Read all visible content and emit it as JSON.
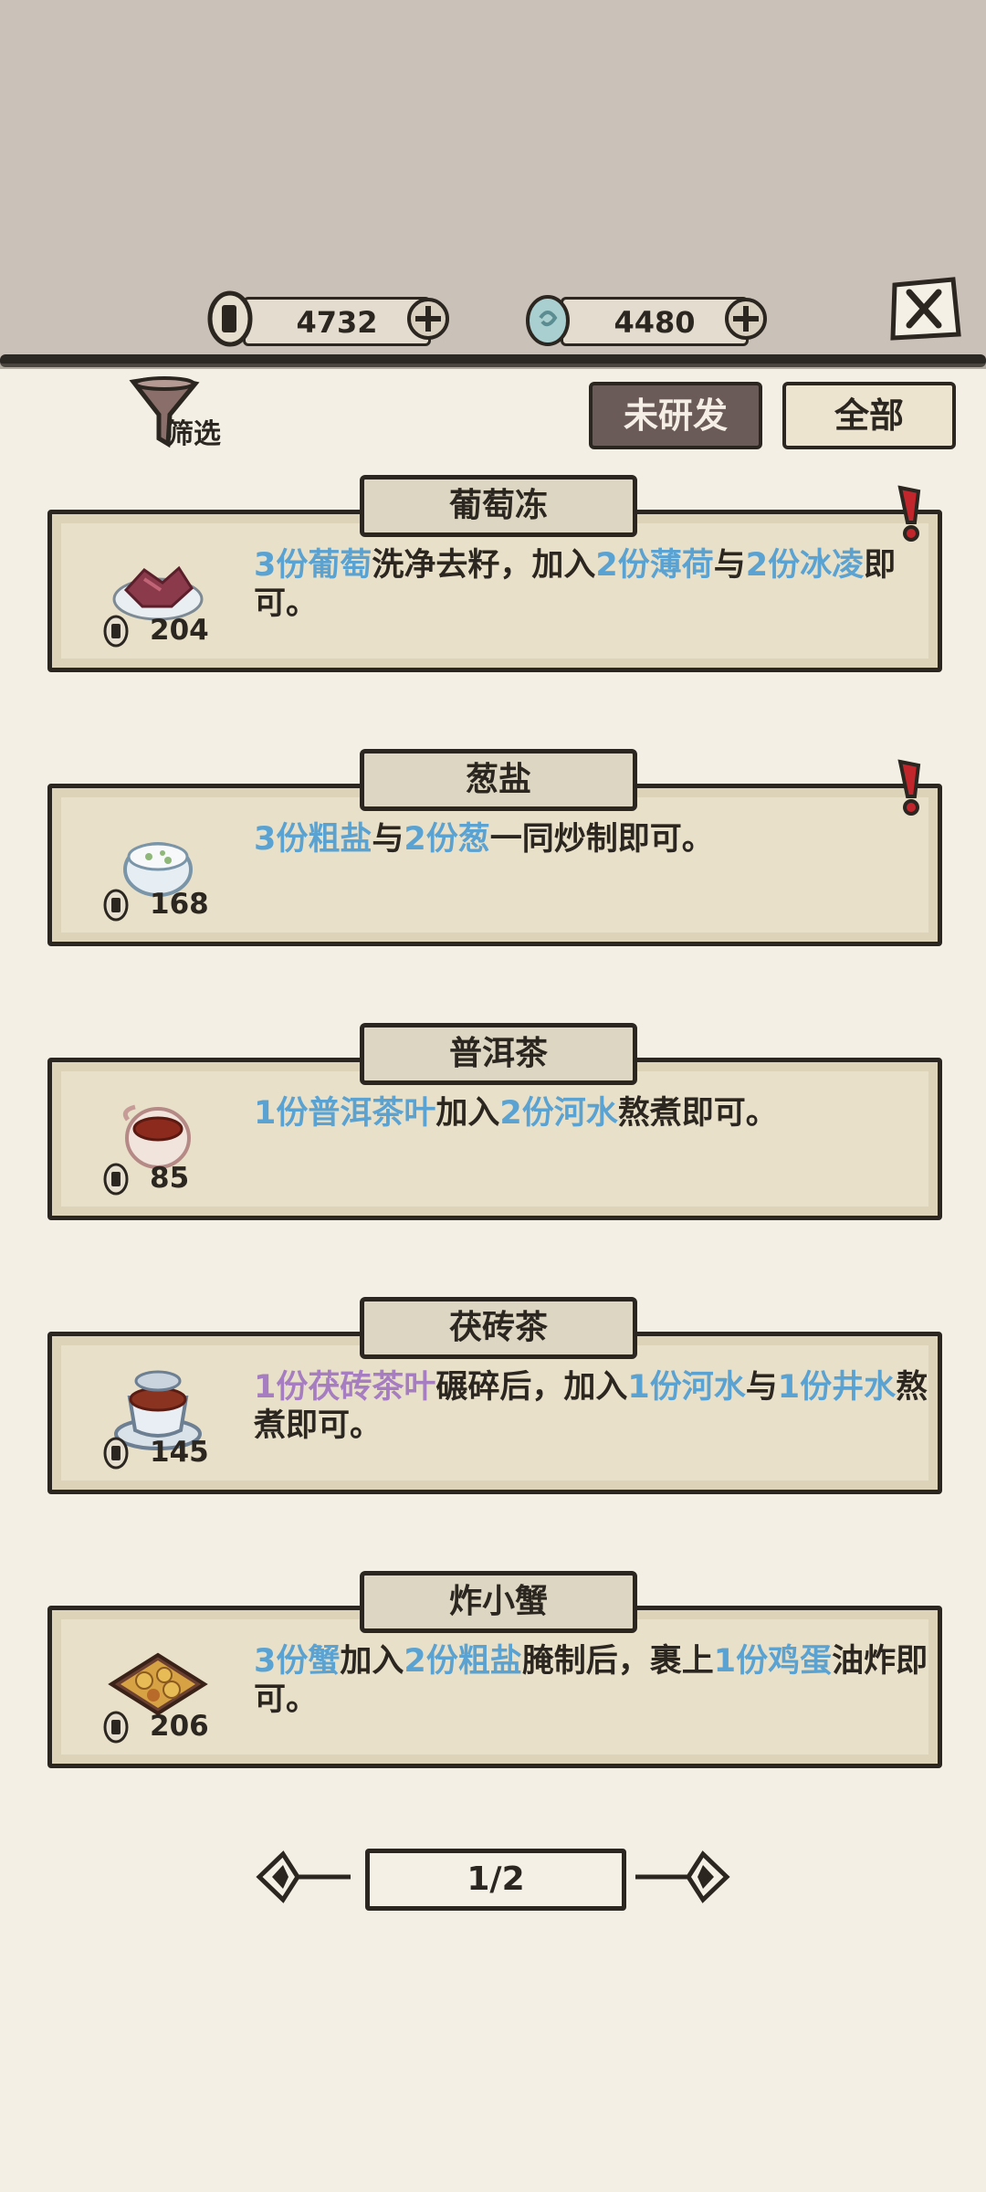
{
  "header": {
    "coins": "4732",
    "jade": "4480"
  },
  "filter": {
    "label": "筛选"
  },
  "tabs": {
    "unresearched": "未研发",
    "all": "全部"
  },
  "recipes": [
    {
      "title": "葡萄冻",
      "price": "204",
      "dish_icon": "grape-jelly-icon",
      "alert": true,
      "segments": [
        {
          "text": "3份葡萄",
          "hl": "blue"
        },
        {
          "text": "洗净去籽，加入",
          "hl": ""
        },
        {
          "text": "2份薄荷",
          "hl": "blue"
        },
        {
          "text": "与",
          "hl": ""
        },
        {
          "text": "2份冰凌",
          "hl": "blue"
        },
        {
          "text": "即可。",
          "hl": ""
        }
      ]
    },
    {
      "title": "葱盐",
      "price": "168",
      "dish_icon": "scallion-salt-icon",
      "alert": true,
      "segments": [
        {
          "text": "3份粗盐",
          "hl": "blue"
        },
        {
          "text": "与",
          "hl": ""
        },
        {
          "text": "2份葱",
          "hl": "blue"
        },
        {
          "text": "一同炒制即可。",
          "hl": ""
        }
      ]
    },
    {
      "title": "普洱茶",
      "price": "85",
      "dish_icon": "puer-tea-icon",
      "alert": false,
      "segments": [
        {
          "text": "1份普洱茶叶",
          "hl": "blue"
        },
        {
          "text": "加入",
          "hl": ""
        },
        {
          "text": "2份河水",
          "hl": "blue"
        },
        {
          "text": "熬煮即可。",
          "hl": ""
        }
      ]
    },
    {
      "title": "茯砖茶",
      "price": "145",
      "dish_icon": "fuzhuan-tea-icon",
      "alert": false,
      "segments": [
        {
          "text": "1份茯砖茶叶",
          "hl": "purple"
        },
        {
          "text": "碾碎后，加入",
          "hl": ""
        },
        {
          "text": "1份河水",
          "hl": "blue"
        },
        {
          "text": "与",
          "hl": ""
        },
        {
          "text": "1份井水",
          "hl": "blue"
        },
        {
          "text": "熬煮即可。",
          "hl": ""
        }
      ]
    },
    {
      "title": "炸小蟹",
      "price": "206",
      "dish_icon": "fried-crab-icon",
      "alert": false,
      "segments": [
        {
          "text": "3份蟹",
          "hl": "blue"
        },
        {
          "text": "加入",
          "hl": ""
        },
        {
          "text": "2份粗盐",
          "hl": "blue"
        },
        {
          "text": "腌制后，裹上",
          "hl": ""
        },
        {
          "text": "1份鸡蛋",
          "hl": "blue"
        },
        {
          "text": "油炸即可。",
          "hl": ""
        }
      ]
    }
  ],
  "pager": {
    "label": "1/2"
  },
  "colors": {
    "highlight_blue": "#5aa2d2",
    "highlight_purple": "#a77dc2",
    "ink": "#2b2620",
    "alert_red": "#c0262b"
  }
}
